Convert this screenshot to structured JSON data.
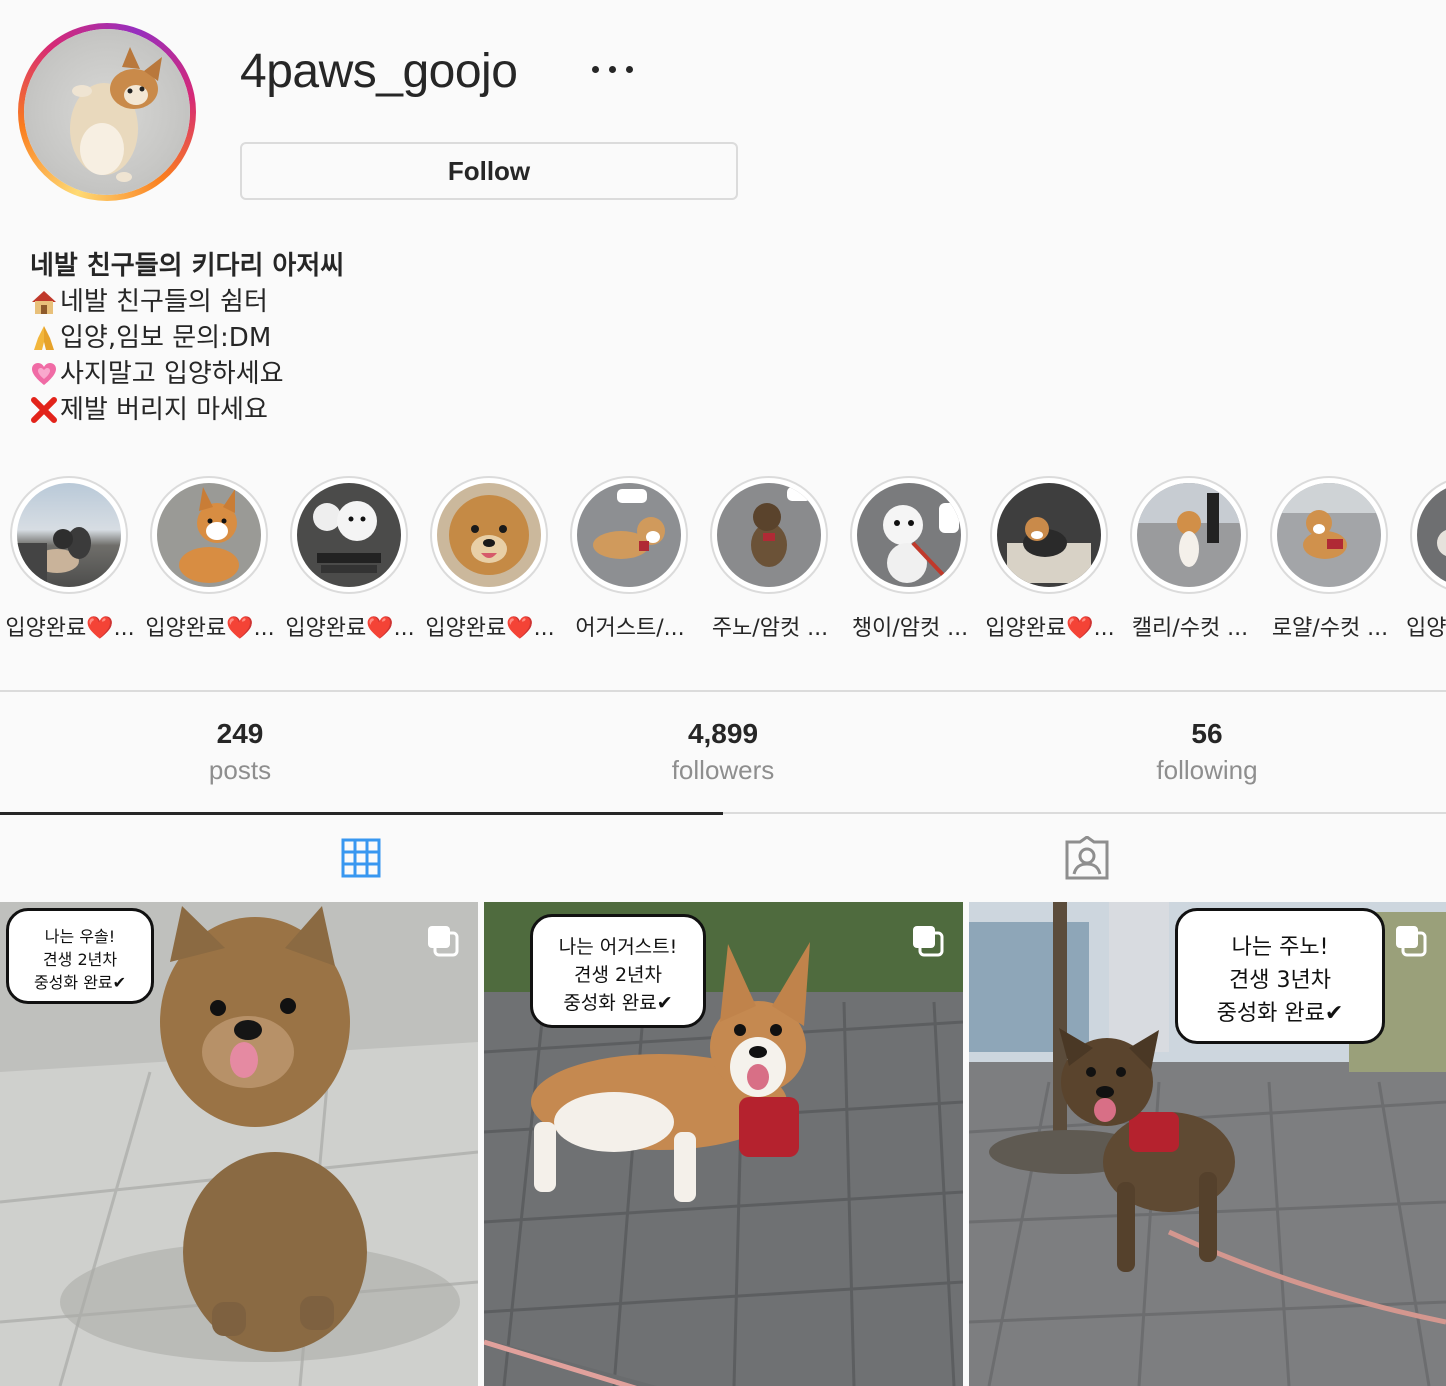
{
  "profile": {
    "username": "4paws_goojo",
    "more_icon": "ellipsis-icon",
    "follow_label": "Follow"
  },
  "bio": {
    "name": "네발 친구들의 키다리 아저씨",
    "lines": [
      {
        "icon": "house-emoji",
        "text": "네발 친구들의 쉼터"
      },
      {
        "icon": "folded-hands-emoji",
        "text": "입양,임보 문의:DM"
      },
      {
        "icon": "growing-heart-emoji",
        "text": "사지말고 입양하세요"
      },
      {
        "icon": "red-cross-emoji",
        "text": "제발 버리지 마세요"
      }
    ]
  },
  "highlights": [
    {
      "label": "입양완료❤️..."
    },
    {
      "label": "입양완료❤️..."
    },
    {
      "label": "입양완료❤️..."
    },
    {
      "label": "입양완료❤️..."
    },
    {
      "label": "어거스트/..."
    },
    {
      "label": "주노/암컷 ..."
    },
    {
      "label": "챙이/암컷 ..."
    },
    {
      "label": "입양완료❤️..."
    },
    {
      "label": "캘리/수컷 ..."
    },
    {
      "label": "로얄/수컷 ..."
    },
    {
      "label": "입양"
    }
  ],
  "stats": {
    "posts": {
      "value": "249",
      "label": "posts"
    },
    "followers": {
      "value": "4,899",
      "label": "followers"
    },
    "following": {
      "value": "56",
      "label": "following"
    }
  },
  "tabs": [
    {
      "icon": "grid-icon",
      "active": true
    },
    {
      "icon": "tagged-icon",
      "active": false
    }
  ],
  "posts": [
    {
      "bubble": [
        "나는 우솔!",
        "견생 2년차",
        "중성화 완료✔"
      ],
      "type_icon": "carousel-icon"
    },
    {
      "bubble": [
        "나는 어거스트!",
        "견생 2년차",
        "중성화 완료✔"
      ],
      "type_icon": "carousel-icon"
    },
    {
      "bubble": [
        "나는 주노!",
        "견생 3년차",
        "중성화 완료✔"
      ],
      "type_icon": "carousel-icon"
    }
  ],
  "colors": {
    "background": "#fafafa",
    "text": "#262626",
    "muted": "#8e8e8e",
    "border": "#dbdbdb",
    "active_tab_icon": "#3897f0"
  }
}
